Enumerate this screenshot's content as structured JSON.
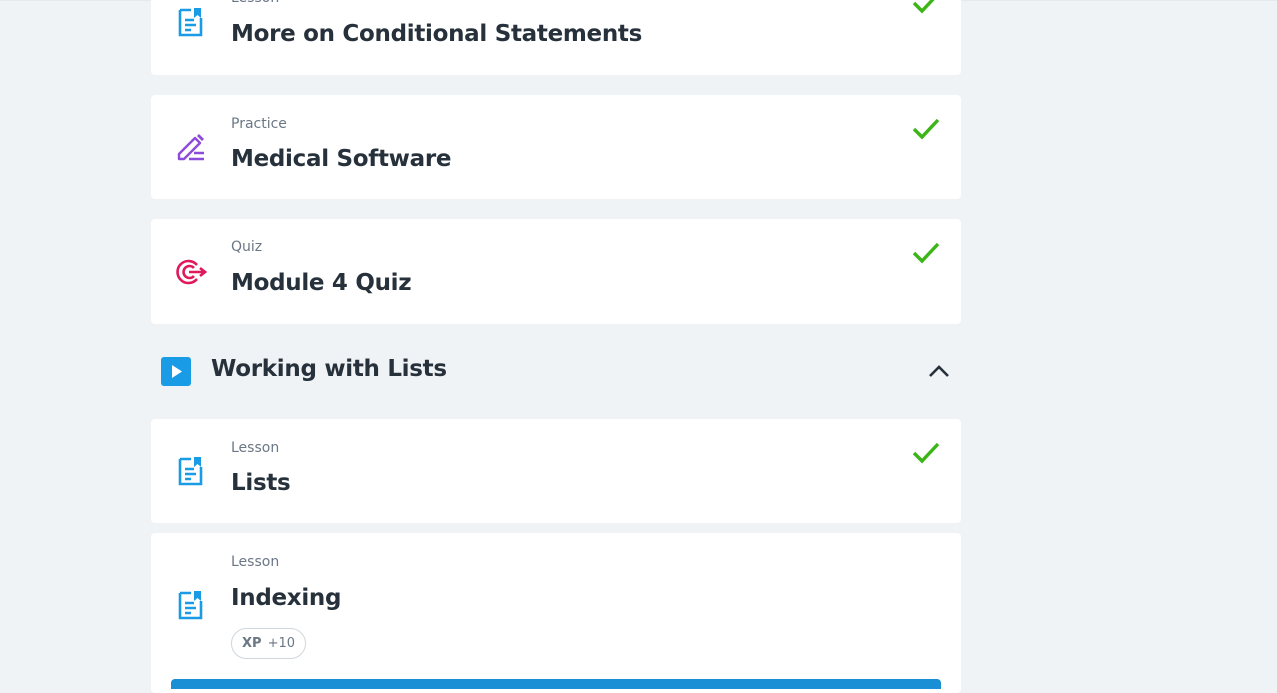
{
  "items": [
    {
      "kind": "Lesson",
      "title": "More on Conditional Statements",
      "icon": "lesson-document-icon",
      "completed": true
    },
    {
      "kind": "Practice",
      "title": "Medical Software",
      "icon": "practice-pencil-icon",
      "completed": true
    },
    {
      "kind": "Quiz",
      "title": "Module 4 Quiz",
      "icon": "quiz-target-icon",
      "completed": true
    }
  ],
  "section": {
    "title": "Working with Lists",
    "icon": "play-icon",
    "toggle_icon": "chevron-up-icon"
  },
  "section_items": [
    {
      "kind": "Lesson",
      "title": "Lists",
      "icon": "lesson-document-icon",
      "completed": true
    },
    {
      "kind": "Lesson",
      "title": "Indexing",
      "icon": "lesson-document-icon",
      "completed": false,
      "xp_label": "XP",
      "xp_value": "+10"
    }
  ],
  "colors": {
    "background": "#f0f3f6",
    "lesson_icon": "#1a9be6",
    "practice_icon": "#8c4bdb",
    "quiz_icon": "#e0185c",
    "check": "#3cb517",
    "title_text": "#27313b",
    "accent_bar": "#1a8fd6"
  }
}
